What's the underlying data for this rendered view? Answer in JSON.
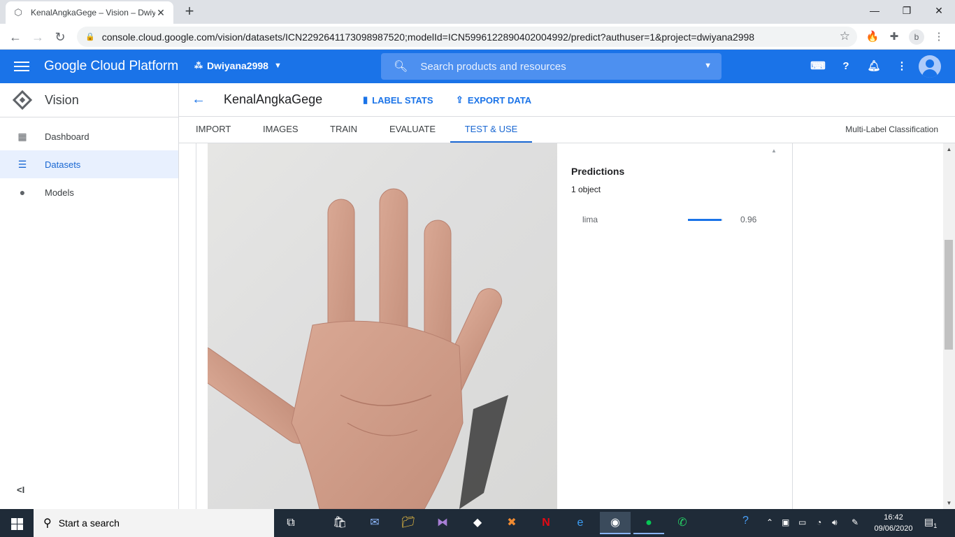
{
  "browser": {
    "tab_title": "KenalAngkaGege – Vision – Dwiy",
    "url": "console.cloud.google.com/vision/datasets/ICN2292641173098987520;modelId=ICN5996122890402004992/predict?authuser=1&project=dwiyana2998"
  },
  "header": {
    "brand": "Google Cloud Platform",
    "project": "Dwiyana2998",
    "search_placeholder": "Search products and resources"
  },
  "sidebar": {
    "product": "Vision",
    "items": [
      {
        "label": "Dashboard",
        "icon": "dashboard-icon"
      },
      {
        "label": "Datasets",
        "icon": "list-icon"
      },
      {
        "label": "Models",
        "icon": "lightbulb-icon"
      }
    ],
    "collapse_label": "<I"
  },
  "main": {
    "dataset_title": "KenalAngkaGege",
    "label_stats": "LABEL STATS",
    "export_data": "EXPORT DATA",
    "tabs": [
      "IMPORT",
      "IMAGES",
      "TRAIN",
      "EVALUATE",
      "TEST & USE"
    ],
    "active_tab": "TEST & USE",
    "model_type": "Multi-Label Classification"
  },
  "predictions": {
    "title": "Predictions",
    "count": "1 object",
    "items": [
      {
        "label": "lima",
        "score": "0.96",
        "value": 0.96
      }
    ]
  },
  "taskbar": {
    "search_text": "Start a search",
    "time": "16:42",
    "date": "09/06/2020",
    "notification_count": "1"
  },
  "colors": {
    "brand_blue": "#1a73e8",
    "taskbar": "#1f2b38"
  }
}
